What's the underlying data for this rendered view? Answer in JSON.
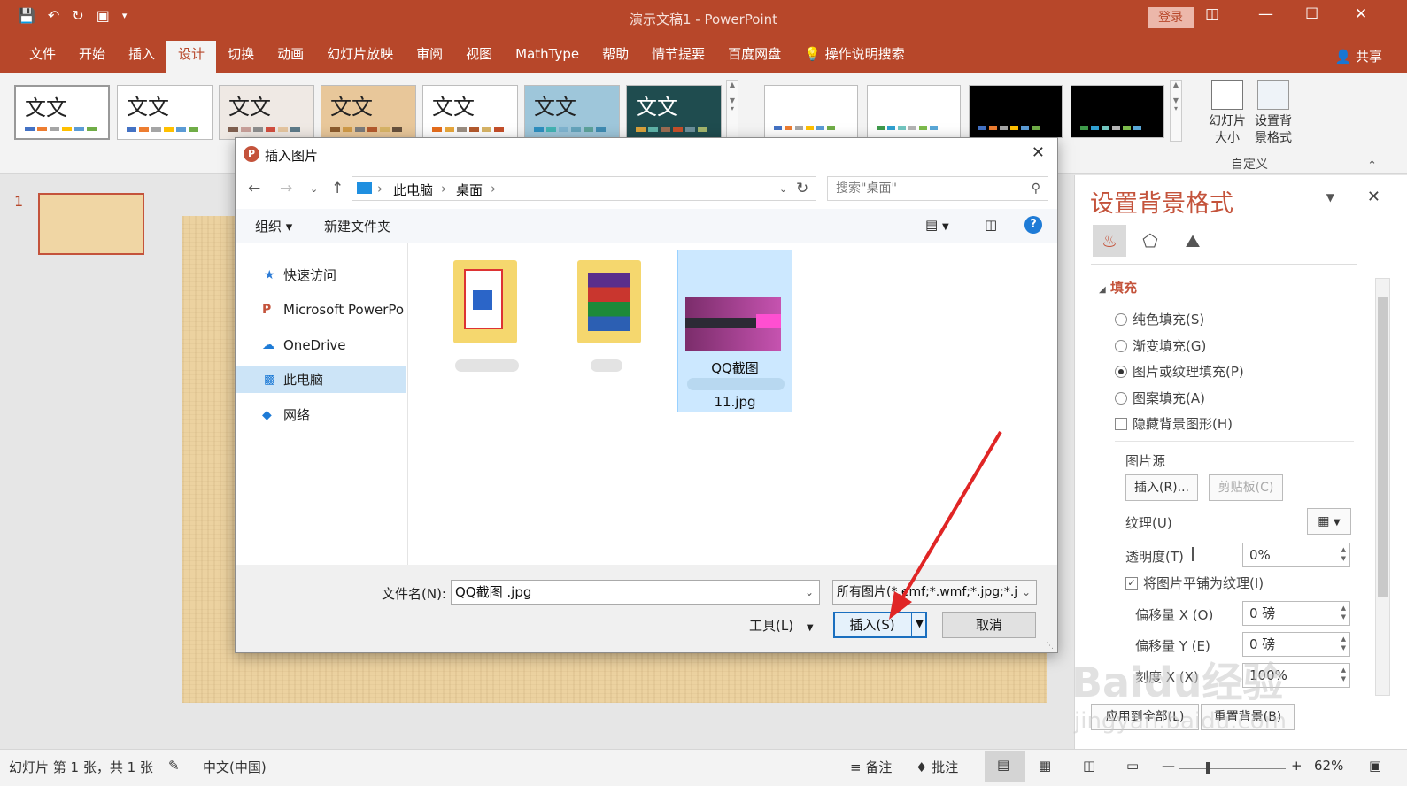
{
  "app": {
    "window_title": "演示文稿1  -  PowerPoint",
    "login": "登录",
    "share": "共享",
    "tabs": [
      "文件",
      "开始",
      "插入",
      "设计",
      "切换",
      "动画",
      "幻灯片放映",
      "审阅",
      "视图",
      "MathType",
      "帮助",
      "情节提要",
      "百度网盘"
    ],
    "active_tab": "设计",
    "search_hint": "操作说明搜索"
  },
  "ribbon": {
    "theme_sample_text": "文文",
    "custom": {
      "slide_size": "幻灯片大小",
      "format_background": "设置背景格式",
      "group_label": "自定义"
    }
  },
  "slides": {
    "number": "1"
  },
  "format_pane": {
    "title": "设置背景格式",
    "section_fill": "填充",
    "options": [
      "纯色填充(S)",
      "渐变填充(G)",
      "图片或纹理填充(P)",
      "图案填充(A)"
    ],
    "selected_option": "图片或纹理填充(P)",
    "hide_bg": "隐藏背景图形(H)",
    "picture_source": "图片源",
    "insert_btn": "插入(R)...",
    "clipboard_btn": "剪贴板(C)",
    "texture_label": "纹理(U)",
    "transparency_label": "透明度(T)",
    "transparency_value": "0%",
    "tile_label": "将图片平铺为纹理(I)",
    "offset_x_label": "偏移量 X (O)",
    "offset_x_value": "0 磅",
    "offset_y_label": "偏移量 Y (E)",
    "offset_y_value": "0 磅",
    "scale_x_label": "刻度 X (X)",
    "scale_x_value": "100%",
    "apply_all": "应用到全部(L)",
    "reset_bg": "重置背景(B)"
  },
  "dialog": {
    "title": "插入图片",
    "breadcrumb": [
      "此电脑",
      "桌面"
    ],
    "search_placeholder": "搜索\"桌面\"",
    "organize": "组织 ▾",
    "new_folder": "新建文件夹",
    "nav": [
      "快速访问",
      "Microsoft PowerPo",
      "OneDrive",
      "此电脑",
      "网络"
    ],
    "nav_selected": "此电脑",
    "selected_file_line1": "QQ截图",
    "selected_file_line2": "11.jpg",
    "filename_label": "文件名(N):",
    "filename_value": "QQ截图                        .jpg",
    "filetype_value": "所有图片(*.emf;*.wmf;*.jpg;*.j",
    "tools": "工具(L)",
    "insert": "插入(S)",
    "cancel": "取消"
  },
  "statusbar": {
    "slide_info": "幻灯片 第 1 张，共 1 张",
    "language": "中文(中国)",
    "notes": "备注",
    "comments": "批注",
    "zoom": "62%"
  },
  "colors": {
    "accent": "#b7472a",
    "selected_blue": "#cce8ff",
    "arrow": "#e02525"
  },
  "watermark": {
    "text": "Baidu经验",
    "sub": "jingyan.baidu.com"
  }
}
